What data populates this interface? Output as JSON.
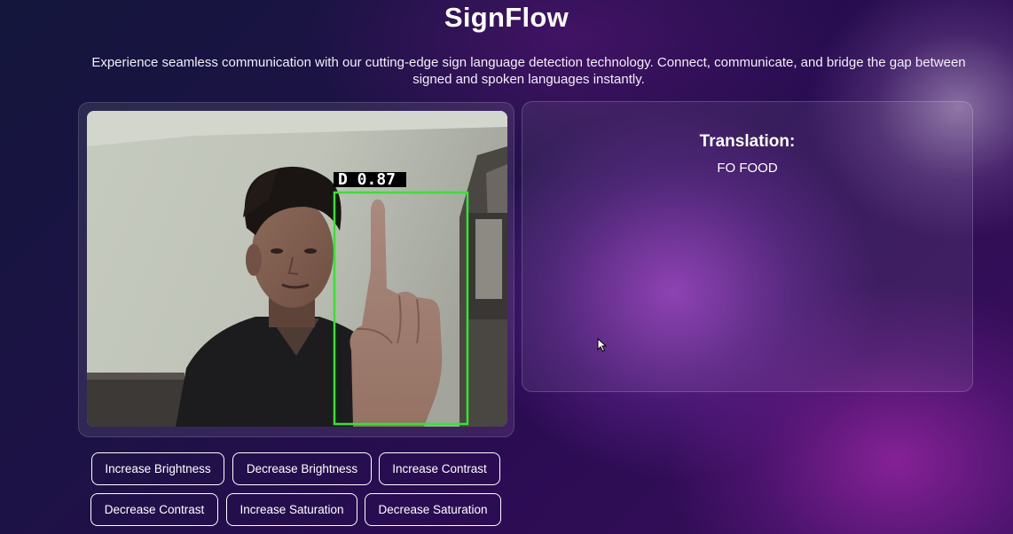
{
  "header": {
    "title": "SignFlow",
    "subtitle": "Experience seamless communication with our cutting-edge sign language detection technology. Connect, communicate, and bridge the gap between signed and spoken languages instantly."
  },
  "camera": {
    "detection_label": "D 0.87",
    "box_color": "#2ee82e"
  },
  "translation": {
    "heading": "Translation:",
    "text": "FO FOOD"
  },
  "controls": {
    "increase_brightness": "Increase Brightness",
    "decrease_brightness": "Decrease Brightness",
    "increase_contrast": "Increase Contrast",
    "decrease_contrast": "Decrease Contrast",
    "increase_saturation": "Increase Saturation",
    "decrease_saturation": "Decrease Saturation"
  },
  "icons": {
    "cursor": "mouse-pointer-icon"
  }
}
